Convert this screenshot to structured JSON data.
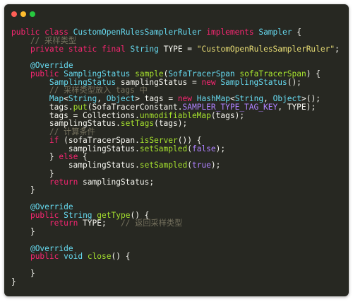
{
  "window": {
    "controls": {
      "close_color": "#ff5f56",
      "minimize_color": "#ffbd2e",
      "maximize_color": "#27c93f"
    },
    "theme": {
      "background": "#272822"
    }
  },
  "code": {
    "lines": [
      [
        {
          "t": "public",
          "c": "kw"
        },
        {
          "t": " ",
          "c": "plain"
        },
        {
          "t": "class",
          "c": "kw"
        },
        {
          "t": " ",
          "c": "plain"
        },
        {
          "t": "CustomOpenRulesSamplerRuler",
          "c": "type"
        },
        {
          "t": " ",
          "c": "plain"
        },
        {
          "t": "implements",
          "c": "kw"
        },
        {
          "t": " ",
          "c": "plain"
        },
        {
          "t": "Sampler",
          "c": "type"
        },
        {
          "t": " {",
          "c": "plain"
        }
      ],
      [
        {
          "t": "    // 采样类型",
          "c": "cmt"
        }
      ],
      [
        {
          "t": "    ",
          "c": "plain"
        },
        {
          "t": "private",
          "c": "kw"
        },
        {
          "t": " ",
          "c": "plain"
        },
        {
          "t": "static",
          "c": "kw"
        },
        {
          "t": " ",
          "c": "plain"
        },
        {
          "t": "final",
          "c": "kw"
        },
        {
          "t": " ",
          "c": "plain"
        },
        {
          "t": "String",
          "c": "type"
        },
        {
          "t": " TYPE = ",
          "c": "plain"
        },
        {
          "t": "\"CustomOpenRulesSamplerRuler\"",
          "c": "str"
        },
        {
          "t": ";",
          "c": "plain"
        }
      ],
      [],
      [
        {
          "t": "    ",
          "c": "plain"
        },
        {
          "t": "@Override",
          "c": "anno"
        }
      ],
      [
        {
          "t": "    ",
          "c": "plain"
        },
        {
          "t": "public",
          "c": "kw"
        },
        {
          "t": " ",
          "c": "plain"
        },
        {
          "t": "SamplingStatus",
          "c": "type"
        },
        {
          "t": " ",
          "c": "plain"
        },
        {
          "t": "sample",
          "c": "fn"
        },
        {
          "t": "(",
          "c": "plain"
        },
        {
          "t": "SofaTracerSpan",
          "c": "type"
        },
        {
          "t": " ",
          "c": "plain"
        },
        {
          "t": "sofaTracerSpan",
          "c": "fn"
        },
        {
          "t": ") {",
          "c": "plain"
        }
      ],
      [
        {
          "t": "        ",
          "c": "plain"
        },
        {
          "t": "SamplingStatus",
          "c": "type"
        },
        {
          "t": " samplingStatus = ",
          "c": "plain"
        },
        {
          "t": "new",
          "c": "kw"
        },
        {
          "t": " ",
          "c": "plain"
        },
        {
          "t": "SamplingStatus",
          "c": "type"
        },
        {
          "t": "();",
          "c": "plain"
        }
      ],
      [
        {
          "t": "        // 采样类型放入 tags 中",
          "c": "cmt"
        }
      ],
      [
        {
          "t": "        ",
          "c": "plain"
        },
        {
          "t": "Map",
          "c": "type"
        },
        {
          "t": "<",
          "c": "plain"
        },
        {
          "t": "String",
          "c": "type"
        },
        {
          "t": ", ",
          "c": "plain"
        },
        {
          "t": "Object",
          "c": "type"
        },
        {
          "t": "> tags = ",
          "c": "plain"
        },
        {
          "t": "new",
          "c": "kw"
        },
        {
          "t": " ",
          "c": "plain"
        },
        {
          "t": "HashMap",
          "c": "type"
        },
        {
          "t": "<",
          "c": "plain"
        },
        {
          "t": "String",
          "c": "type"
        },
        {
          "t": ", ",
          "c": "plain"
        },
        {
          "t": "Object",
          "c": "type"
        },
        {
          "t": ">();",
          "c": "plain"
        }
      ],
      [
        {
          "t": "        tags.",
          "c": "plain"
        },
        {
          "t": "put",
          "c": "fn"
        },
        {
          "t": "(SofaTracerConstant.",
          "c": "plain"
        },
        {
          "t": "SAMPLER_TYPE_TAG_KEY",
          "c": "const"
        },
        {
          "t": ", TYPE);",
          "c": "plain"
        }
      ],
      [
        {
          "t": "        tags = Collections.",
          "c": "plain"
        },
        {
          "t": "unmodifiableMap",
          "c": "fn"
        },
        {
          "t": "(tags);",
          "c": "plain"
        }
      ],
      [
        {
          "t": "        samplingStatus.",
          "c": "plain"
        },
        {
          "t": "setTags",
          "c": "fn"
        },
        {
          "t": "(tags);",
          "c": "plain"
        }
      ],
      [
        {
          "t": "        // 计算条件",
          "c": "cmt"
        }
      ],
      [
        {
          "t": "        ",
          "c": "plain"
        },
        {
          "t": "if",
          "c": "kw"
        },
        {
          "t": " (sofaTracerSpan.",
          "c": "plain"
        },
        {
          "t": "isServer",
          "c": "fn"
        },
        {
          "t": "()) {",
          "c": "plain"
        }
      ],
      [
        {
          "t": "            samplingStatus.",
          "c": "plain"
        },
        {
          "t": "setSampled",
          "c": "fn"
        },
        {
          "t": "(",
          "c": "plain"
        },
        {
          "t": "false",
          "c": "lit"
        },
        {
          "t": ");",
          "c": "plain"
        }
      ],
      [
        {
          "t": "        } ",
          "c": "plain"
        },
        {
          "t": "else",
          "c": "kw"
        },
        {
          "t": " {",
          "c": "plain"
        }
      ],
      [
        {
          "t": "            samplingStatus.",
          "c": "plain"
        },
        {
          "t": "setSampled",
          "c": "fn"
        },
        {
          "t": "(",
          "c": "plain"
        },
        {
          "t": "true",
          "c": "lit"
        },
        {
          "t": ");",
          "c": "plain"
        }
      ],
      [
        {
          "t": "        }",
          "c": "plain"
        }
      ],
      [
        {
          "t": "        ",
          "c": "plain"
        },
        {
          "t": "return",
          "c": "kw"
        },
        {
          "t": " samplingStatus;",
          "c": "plain"
        }
      ],
      [
        {
          "t": "    }",
          "c": "plain"
        }
      ],
      [],
      [
        {
          "t": "    ",
          "c": "plain"
        },
        {
          "t": "@Override",
          "c": "anno"
        }
      ],
      [
        {
          "t": "    ",
          "c": "plain"
        },
        {
          "t": "public",
          "c": "kw"
        },
        {
          "t": " ",
          "c": "plain"
        },
        {
          "t": "String",
          "c": "type"
        },
        {
          "t": " ",
          "c": "plain"
        },
        {
          "t": "getType",
          "c": "fn"
        },
        {
          "t": "() {",
          "c": "plain"
        }
      ],
      [
        {
          "t": "        ",
          "c": "plain"
        },
        {
          "t": "return",
          "c": "kw"
        },
        {
          "t": " TYPE;   ",
          "c": "plain"
        },
        {
          "t": "// 返回采样类型",
          "c": "cmt"
        }
      ],
      [
        {
          "t": "    }",
          "c": "plain"
        }
      ],
      [],
      [
        {
          "t": "    ",
          "c": "plain"
        },
        {
          "t": "@Override",
          "c": "anno"
        }
      ],
      [
        {
          "t": "    ",
          "c": "plain"
        },
        {
          "t": "public",
          "c": "kw"
        },
        {
          "t": " ",
          "c": "plain"
        },
        {
          "t": "void",
          "c": "type"
        },
        {
          "t": " ",
          "c": "plain"
        },
        {
          "t": "close",
          "c": "fn"
        },
        {
          "t": "() {",
          "c": "plain"
        }
      ],
      [],
      [
        {
          "t": "    }",
          "c": "plain"
        }
      ],
      [
        {
          "t": "}",
          "c": "plain"
        }
      ]
    ]
  }
}
